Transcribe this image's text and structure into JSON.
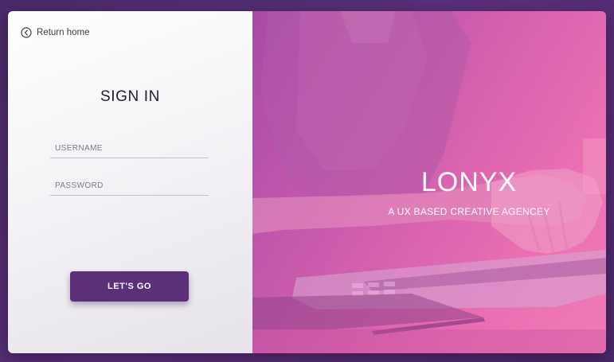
{
  "login": {
    "return_home_label": "Return home",
    "title": "SIGN IN",
    "username_placeholder": "USERNAME",
    "password_placeholder": "PASSWORD",
    "submit_label": "LET'S GO"
  },
  "hero": {
    "brand": "LONYX",
    "tagline": "A UX BASED CREATIVE AGENCEY"
  },
  "icons": {
    "return": "chevron-left-circle-icon"
  },
  "colors": {
    "background": "#4a2a6b",
    "button": "#5a3078",
    "hero_overlay_start": "#a84aa6",
    "hero_overlay_end": "#f07bb8"
  }
}
